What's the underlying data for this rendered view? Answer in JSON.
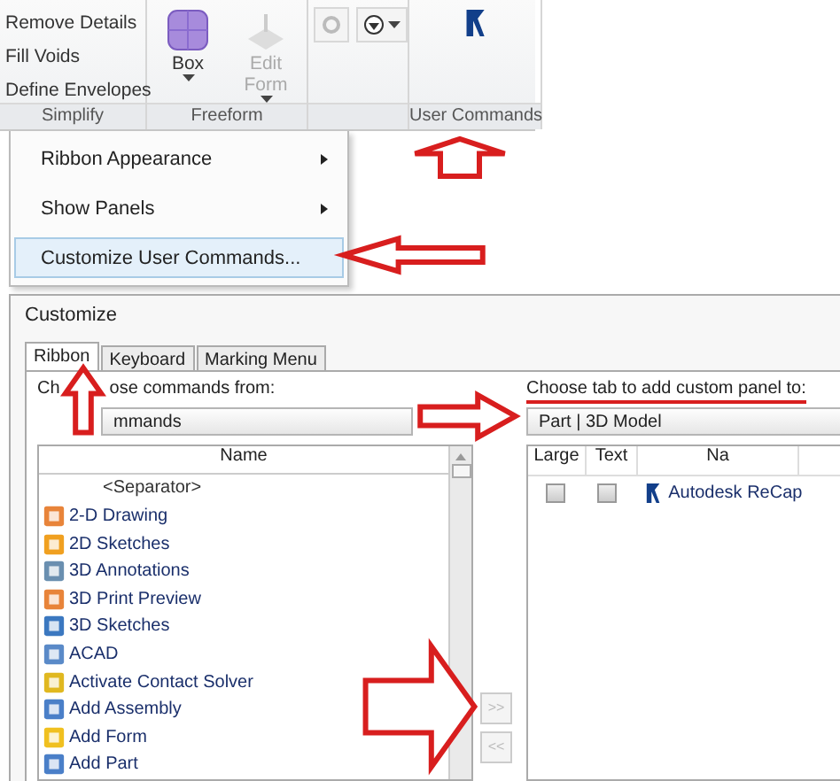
{
  "ribbon": {
    "tools": [
      {
        "label": "Remove Details"
      },
      {
        "label": "Fill Voids"
      },
      {
        "label": "Define Envelopes"
      }
    ],
    "large_buttons": [
      {
        "label": "Box",
        "disabled": false
      },
      {
        "label": "Edit Form",
        "disabled": true
      }
    ],
    "panels": [
      "Simplify",
      "Freeform",
      "User Commands"
    ]
  },
  "context_menu": {
    "items": [
      {
        "label": "Ribbon Appearance",
        "submenu": true,
        "selected": false
      },
      {
        "label": "Show Panels",
        "submenu": true,
        "selected": false
      },
      {
        "label": "Customize User Commands...",
        "submenu": false,
        "selected": true
      }
    ]
  },
  "dialog": {
    "title": "Customize",
    "tabs": [
      {
        "label": "Ribbon",
        "selected": true
      },
      {
        "label": "Keyboard",
        "selected": false
      },
      {
        "label": "Marking Menu",
        "selected": false
      }
    ],
    "left": {
      "label_parts": [
        "Ch",
        "ose commands from:"
      ],
      "dropdown": "mmands",
      "column": "Name",
      "items": [
        {
          "label": "<Separator>",
          "kind": "separator"
        },
        {
          "label": "2-D Drawing",
          "kind": "command"
        },
        {
          "label": "2D Sketches",
          "kind": "command"
        },
        {
          "label": "3D Annotations",
          "kind": "command"
        },
        {
          "label": "3D Print Preview",
          "kind": "command"
        },
        {
          "label": "3D Sketches",
          "kind": "command"
        },
        {
          "label": "ACAD",
          "kind": "command"
        },
        {
          "label": "Activate Contact Solver",
          "kind": "command"
        },
        {
          "label": "Add Assembly",
          "kind": "command"
        },
        {
          "label": "Add Form",
          "kind": "command"
        },
        {
          "label": "Add Part",
          "kind": "command"
        }
      ]
    },
    "buttons": [
      ">>",
      "<<"
    ],
    "right": {
      "label": "Choose tab to add custom panel to:",
      "dropdown": "Part | 3D Model",
      "columns": [
        "Large",
        "Text",
        "Na"
      ],
      "rows": [
        {
          "large": false,
          "text": false,
          "name": "Autodesk ReCap"
        }
      ]
    }
  }
}
